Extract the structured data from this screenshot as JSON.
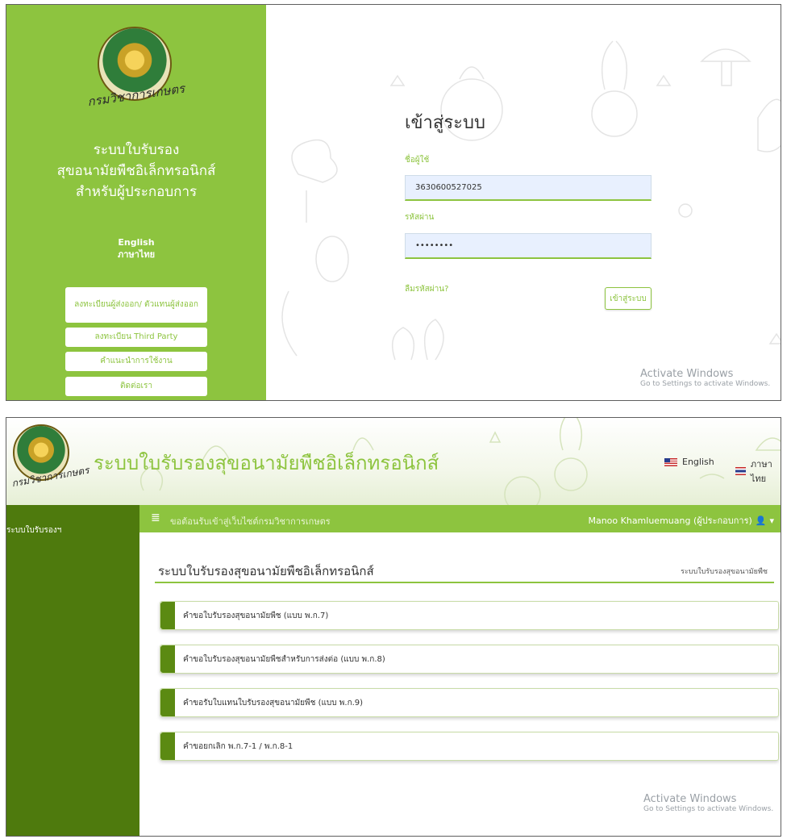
{
  "login": {
    "logo_text": "กรมวิชาการเกษตร",
    "system_title_lines": [
      "ระบบใบรับรอง",
      "สุขอนามัยพืชอิเล็กทรอนิกส์",
      "สำหรับผู้ประกอบการ"
    ],
    "lang_english": "English",
    "lang_thai": "ภาษาไทย",
    "buttons": {
      "register_exporter": "ลงทะเบียนผู้ส่งออก/ ตัวแทนผู้ส่งออก",
      "register_third_party": "ลงทะเบียน Third Party",
      "guide": "คำแนะนำการใช้งาน",
      "contact": "ติดต่อเรา"
    },
    "heading": "เข้าสู่ระบบ",
    "username_label": "ชื่อผู้ใช้",
    "username_value": "3630600527025",
    "password_label": "รหัสผ่าน",
    "password_value": "••••••••",
    "forgot_password": "ลืมรหัสผ่าน?",
    "login_button": "เข้าสู่ระบบ",
    "activate_title": "Activate Windows",
    "activate_sub": "Go to Settings to activate Windows."
  },
  "dashboard": {
    "logo_text": "กรมวิชาการเกษตร",
    "header_title": "ระบบใบรับรองสุขอนามัยพืชอิเล็กทรอนิกส์",
    "lang_english": "English",
    "lang_thai": "ภาษาไทย",
    "sidebar_item": "ระบบใบรับรองฯ",
    "welcome": "ขอต้อนรับเข้าสู่เว็บไซต์กรมวิชาการเกษตร",
    "user_name": "Manoo Khamluemuang (ผู้ประกอบการ)",
    "page_title": "ระบบใบรับรองสุขอนามัยพืชอิเล็กทรอนิกส์",
    "breadcrumb": "ระบบใบรับรองสุขอนามัยพืช",
    "menu_items": [
      "คำขอใบรับรองสุขอนามัยพืช (แบบ พ.ก.7)",
      "คำขอใบรับรองสุขอนามัยพืชสำหรับการส่งต่อ (แบบ พ.ก.8)",
      "คำขอรับใบแทนใบรับรองสุขอนามัยพืช (แบบ พ.ก.9)",
      "คำขอยกเลิก พ.ก.7-1 / พ.ก.8-1"
    ],
    "activate_title": "Activate Windows",
    "activate_sub": "Go to Settings to activate Windows."
  },
  "colors": {
    "primary_green": "#8dc43f",
    "dark_green": "#4e7a0d",
    "input_bg": "#e8f0fe"
  },
  "icons": [
    "hamburger-menu-icon",
    "user-icon",
    "caret-down-icon",
    "us-flag-icon",
    "thai-flag-icon"
  ]
}
